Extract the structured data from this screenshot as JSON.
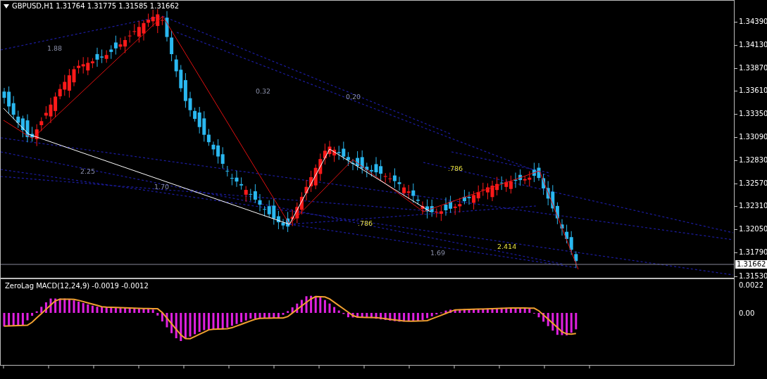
{
  "chart": {
    "symbol_line": "GBPUSD,H1  1.31764 1.31775 1.31585 1.31662",
    "fib_labels": [
      {
        "text": "1.88",
        "color": "#8a8fa8"
      },
      {
        "text": "0.32",
        "color": "#8a8fa8"
      },
      {
        "text": "0.20",
        "color": "#8a8fa8"
      },
      {
        "text": "2.25",
        "color": "#8a8fa8"
      },
      {
        "text": "1.70",
        "color": "#8a8fa8"
      },
      {
        "text": ".786",
        "color": "#e8e040"
      },
      {
        "text": ".786",
        "color": "#e8e040"
      },
      {
        "text": "1.69",
        "color": "#8a8fa8"
      },
      {
        "text": "2.414",
        "color": "#e8e040"
      }
    ],
    "price_axis": [
      "1.34390",
      "1.34130",
      "1.33870",
      "1.33610",
      "1.33350",
      "1.33090",
      "1.32830",
      "1.32570",
      "1.32310",
      "1.32050",
      "1.31790",
      "1.31530"
    ],
    "current_price": "1.31662"
  },
  "indicator": {
    "label": "ZeroLag MACD(12,24,9) -0.0019 -0.0012",
    "axis": [
      "0.0022",
      "0.00"
    ]
  }
}
